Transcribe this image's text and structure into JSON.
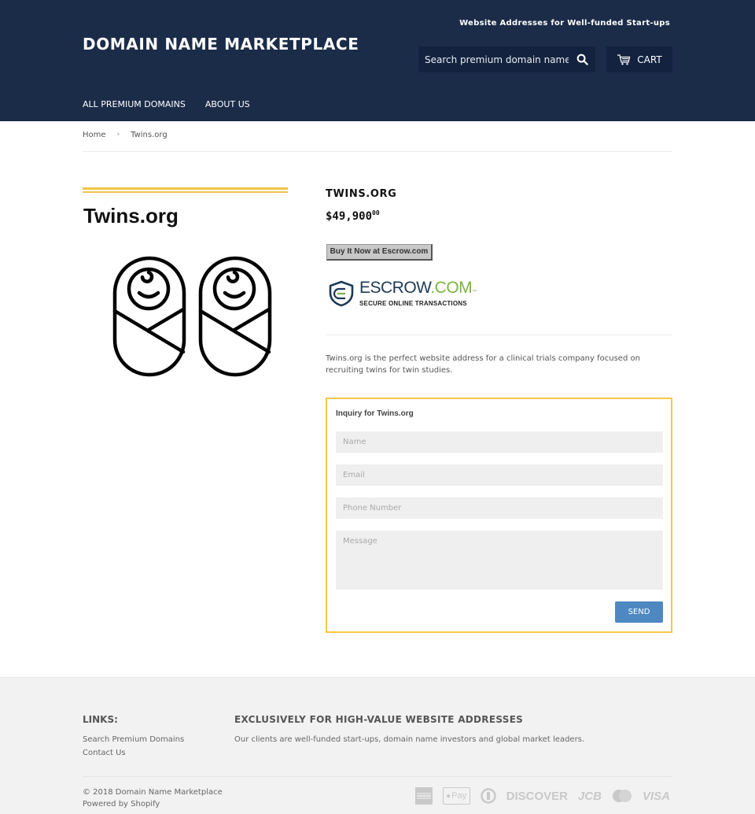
{
  "header": {
    "tagline": "Website Addresses for Well-funded Start-ups",
    "logo": "DOMAIN NAME MARKETPLACE",
    "search_placeholder": "Search premium domain names",
    "cart_label": "CART",
    "nav": [
      {
        "label": "ALL PREMIUM DOMAINS"
      },
      {
        "label": "ABOUT US"
      }
    ]
  },
  "breadcrumb": {
    "home": "Home",
    "separator": "›",
    "current": "Twins.org"
  },
  "product": {
    "image_title": "Twins.org",
    "title": "TWINS.ORG",
    "price_main": "$49,900",
    "price_cents": "00",
    "buy_button": "Buy It Now at Escrow.com",
    "escrow": {
      "brand_part1": "ESCROW",
      "brand_part2": ".COM",
      "tm": "™",
      "subtitle": "SECURE ONLINE TRANSACTIONS"
    },
    "description": "Twins.org is the perfect website address for a clinical trials company focused on recruiting twins for twin studies."
  },
  "inquiry": {
    "title": "Inquiry for Twins.org",
    "name_placeholder": "Name",
    "email_placeholder": "Email",
    "phone_placeholder": "Phone Number",
    "message_placeholder": "Message",
    "send_label": "SEND"
  },
  "footer": {
    "links_title": "LINKS:",
    "links": [
      {
        "label": "Search Premium Domains"
      },
      {
        "label": "Contact Us"
      }
    ],
    "about_title": "EXCLUSIVELY FOR HIGH-VALUE WEBSITE ADDRESSES",
    "about_text": "Our clients are well-funded start-ups, domain name investors and global market leaders.",
    "copyright": "© 2018 Domain Name Marketplace",
    "powered_by": "Powered by Shopify",
    "payment_icons": [
      "american-express",
      "apple-pay",
      "diners-club",
      "discover",
      "jcb",
      "master",
      "visa"
    ],
    "payment_labels": {
      "discover": "DISCOVER",
      "jcb": "JCB",
      "visa": "VISA",
      "apple_pay": "Pay"
    }
  },
  "colors": {
    "header_bg": "#1b2c49",
    "accent_yellow": "#f5c944",
    "send_button": "#4e88c1",
    "footer_bg": "#f2f2f2"
  }
}
